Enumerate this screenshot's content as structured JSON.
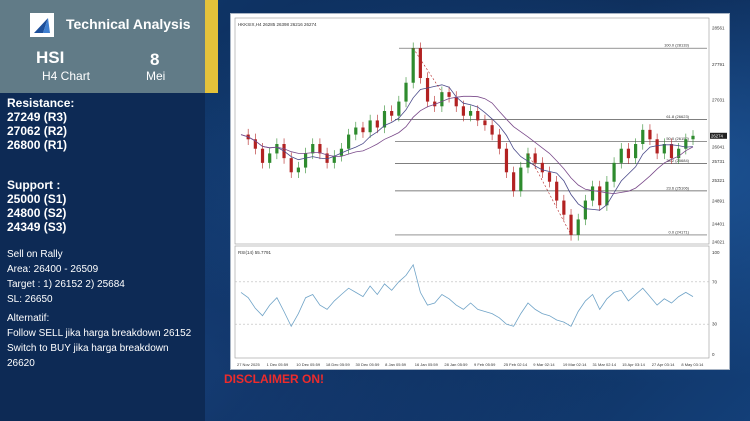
{
  "header": {
    "brand": "Technical Analysis",
    "ticker": "HSI",
    "chart_type": "H4 Chart",
    "date_day": "8",
    "date_month": "Mei"
  },
  "resistance": {
    "title": "Resistance:",
    "levels": [
      "27249 (R3)",
      "27062 (R2)",
      "26800 (R1)"
    ]
  },
  "support": {
    "title": "Support :",
    "levels": [
      "25000 (S1)",
      "24800 (S2)",
      "24349 (S3)"
    ]
  },
  "strategy": {
    "title": "Sell on Rally",
    "area": "Area: 26400 - 26509",
    "target": "Target : 1) 26152 2) 25684",
    "sl": "SL: 26650"
  },
  "alternative": {
    "title": "Alternatif:",
    "line1": "Follow SELL jika harga breakdown 26152",
    "line2": "Switch to BUY jika harga breakdown",
    "line3": "26620"
  },
  "disclaimer": "DISCLAIMER ON!",
  "colors": {
    "header_bg": "#617b87",
    "accent_stripe": "#e4c23a",
    "disclaimer": "#ee2b2b",
    "bull_candle": "#2e8b2e",
    "bear_candle": "#b22222",
    "ma_fast": "#4a4a8a",
    "ma_slow": "#7a4a8a",
    "rsi_line": "#6fa3c7",
    "fib_line": "#555555"
  },
  "chart_data": {
    "type": "line",
    "symbol_label": "HKKSIX,H4 26285 26398 26216 26274",
    "indicator_label": "RSI(14) 55.7791",
    "x_ticks": [
      "27 Nov 2025",
      "1 Dec 05:59",
      "10 Dec 05:59",
      "18 Dec 05:59",
      "30 Dec 05:59",
      "8 Jan 05:59",
      "16 Jan 05:59",
      "28 Jan 05:59",
      "9 Feb 05:59",
      "25 Feb 02:14",
      "9 Mar 02:14",
      "19 Mar 02:14",
      "31 Mar 02:14",
      "15 Apr 03:14",
      "27 Apr 03:14",
      "8 May 03:14"
    ],
    "price_ticks": [
      28561,
      27791,
      27031,
      26041,
      25731,
      25321,
      24891,
      24401,
      24021
    ],
    "ylim": [
      24021,
      28561
    ],
    "fibonacci": [
      {
        "label": "100.0 (28133)",
        "value": 28133
      },
      {
        "label": "61.8 (26623)",
        "value": 26623
      },
      {
        "label": "50.0 (26152)",
        "value": 26152
      },
      {
        "label": "38.2 (25684)",
        "value": 25684
      },
      {
        "label": "23.6 (25106)",
        "value": 25106
      },
      {
        "label": "0.0 (24171)",
        "value": 24171
      }
    ],
    "last_price": 26274,
    "rsi_levels": [
      70,
      30
    ],
    "rsi_ylim": [
      0,
      100
    ],
    "price_path": [
      26300,
      26200,
      26000,
      25700,
      25900,
      26100,
      25800,
      25500,
      25600,
      25900,
      26100,
      25900,
      25700,
      25850,
      26000,
      26300,
      26450,
      26350,
      26600,
      26450,
      26800,
      26700,
      27000,
      27400,
      28133,
      27500,
      27000,
      26900,
      27200,
      27100,
      26900,
      26700,
      26800,
      26600,
      26500,
      26300,
      26000,
      25500,
      25100,
      25600,
      25900,
      25700,
      25500,
      25300,
      24900,
      24600,
      24171,
      24500,
      24900,
      25200,
      24800,
      25300,
      25700,
      26000,
      25800,
      26100,
      26400,
      26200,
      25900,
      26100,
      25800,
      26000,
      26200,
      26274
    ],
    "rsi_path": [
      60,
      55,
      45,
      38,
      48,
      55,
      42,
      28,
      40,
      55,
      58,
      48,
      44,
      52,
      58,
      64,
      60,
      56,
      66,
      58,
      68,
      62,
      70,
      76,
      86,
      60,
      48,
      50,
      58,
      54,
      48,
      44,
      50,
      44,
      42,
      40,
      36,
      30,
      28,
      40,
      50,
      44,
      40,
      38,
      34,
      32,
      28,
      42,
      52,
      58,
      44,
      54,
      60,
      62,
      52,
      58,
      64,
      56,
      48,
      54,
      50,
      56,
      60,
      56
    ]
  }
}
